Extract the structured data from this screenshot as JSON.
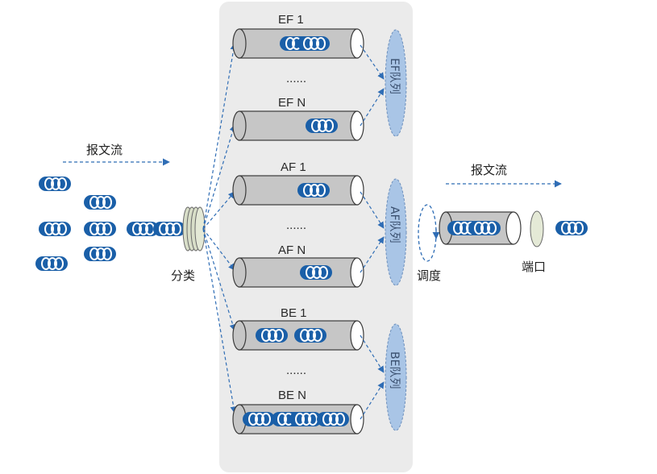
{
  "labels": {
    "input_flow": "报文流",
    "output_flow": "报文流",
    "classify": "分类",
    "schedule": "调度",
    "port": "端口",
    "ellipsis": "......"
  },
  "queues": {
    "ef1": "EF 1",
    "efn": "EF N",
    "af1": "AF 1",
    "afn": "AF N",
    "be1": "BE 1",
    "ben": "BE N"
  },
  "groups": {
    "ef": "EF队列",
    "af": "AF队列",
    "be": "BE队列"
  },
  "colors": {
    "packet_blue": "#1a5fa8",
    "panel_gray": "#ebebeb",
    "arrow_blue": "#2f6db5",
    "cylinder_gray": "#c6c6c6",
    "group_ellipse": "#a9c5e6"
  }
}
